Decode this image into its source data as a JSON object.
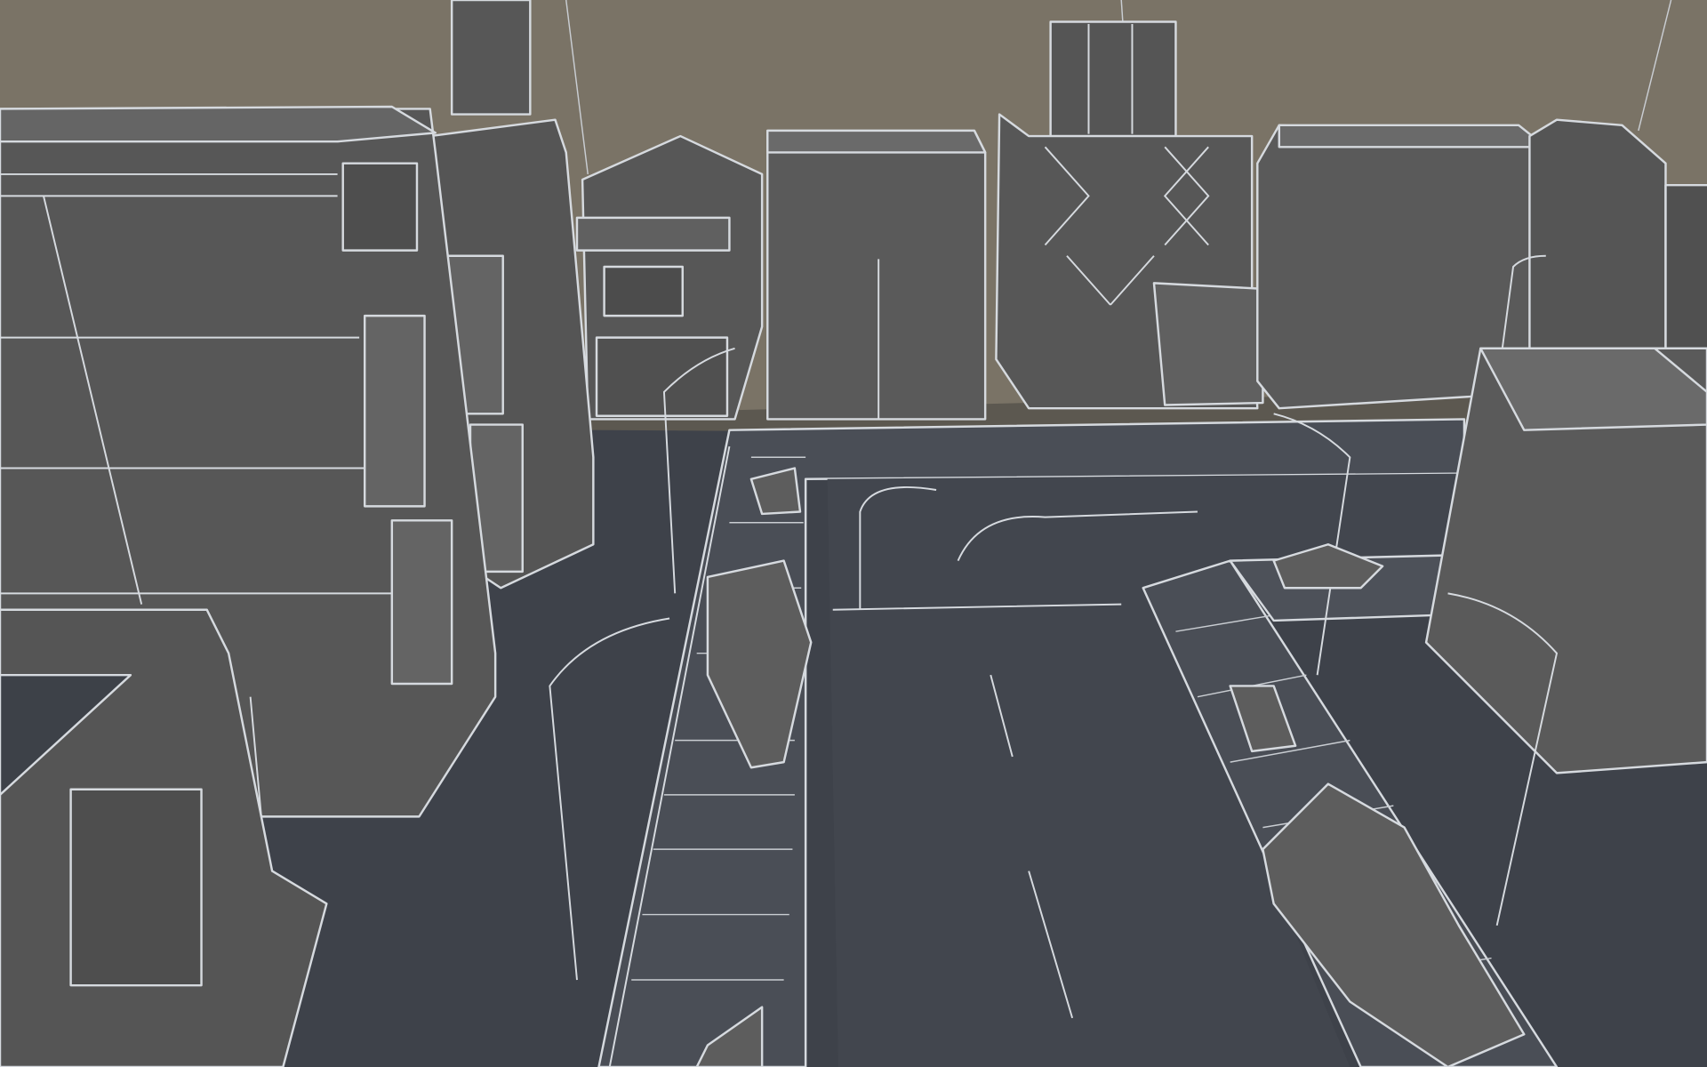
{
  "scene": {
    "colors": {
      "sky": "#7a7366",
      "ground": "#3e424a",
      "road": "#41454d",
      "building": "#585858",
      "building_dark": "#4a4a4a",
      "building_light": "#666666",
      "wire": "#d6dadf"
    }
  }
}
